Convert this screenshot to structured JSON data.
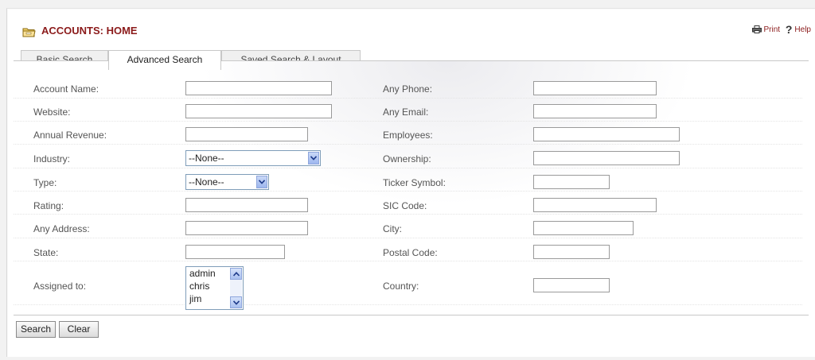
{
  "header": {
    "title": "ACCOUNTS: HOME",
    "print_label": "Print",
    "help_label": "Help"
  },
  "tabs": [
    {
      "label": "Basic Search",
      "active": false
    },
    {
      "label": "Advanced Search",
      "active": true
    },
    {
      "label": "Saved Search & Layout",
      "active": false
    }
  ],
  "form": {
    "account_name": {
      "label": "Account Name:",
      "value": ""
    },
    "any_phone": {
      "label": "Any Phone:",
      "value": ""
    },
    "website": {
      "label": "Website:",
      "value": ""
    },
    "any_email": {
      "label": "Any Email:",
      "value": ""
    },
    "annual_revenue": {
      "label": "Annual Revenue:",
      "value": ""
    },
    "employees": {
      "label": "Employees:",
      "value": ""
    },
    "industry": {
      "label": "Industry:",
      "selected": "--None--"
    },
    "ownership": {
      "label": "Ownership:",
      "value": ""
    },
    "type": {
      "label": "Type:",
      "selected": "--None--"
    },
    "ticker_symbol": {
      "label": "Ticker Symbol:",
      "value": ""
    },
    "rating": {
      "label": "Rating:",
      "value": ""
    },
    "sic_code": {
      "label": "SIC Code:",
      "value": ""
    },
    "any_address": {
      "label": "Any Address:",
      "value": ""
    },
    "city": {
      "label": "City:",
      "value": ""
    },
    "state": {
      "label": "State:",
      "value": ""
    },
    "postal_code": {
      "label": "Postal Code:",
      "value": ""
    },
    "assigned_to": {
      "label": "Assigned to:",
      "options": [
        "admin",
        "chris",
        "jim"
      ]
    },
    "country": {
      "label": "Country:",
      "value": ""
    }
  },
  "buttons": {
    "search": "Search",
    "clear": "Clear"
  },
  "colors": {
    "title": "#8b1a1a",
    "tab_border": "#c8c8c8",
    "select_border": "#7f9db9"
  },
  "icons": {
    "title": "folder-icon",
    "print": "printer-icon",
    "help": "help-icon"
  }
}
